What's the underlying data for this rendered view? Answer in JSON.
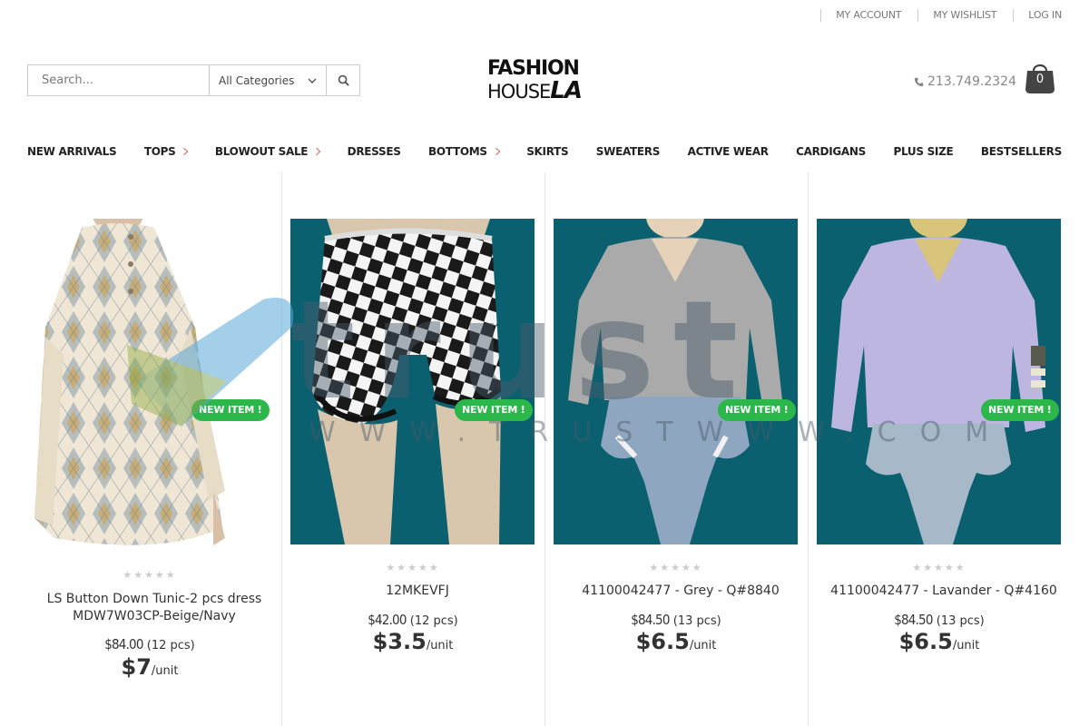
{
  "topbar": {
    "my_account": "MY ACCOUNT",
    "my_wishlist": "MY WISHLIST",
    "login": "LOG IN"
  },
  "search": {
    "placeholder": "Search...",
    "category": "All Categories"
  },
  "logo": {
    "line1": "FASHION",
    "line2a": "HOUSE",
    "line2b": "LA"
  },
  "phone": "213.749.2324",
  "cart": {
    "count": "0"
  },
  "nav": [
    {
      "label": "NEW ARRIVALS",
      "dropdown": false
    },
    {
      "label": "TOPS",
      "dropdown": true
    },
    {
      "label": "BLOWOUT SALE",
      "dropdown": true
    },
    {
      "label": "DRESSES",
      "dropdown": false
    },
    {
      "label": "BOTTOMS",
      "dropdown": true
    },
    {
      "label": "SKIRTS",
      "dropdown": false
    },
    {
      "label": "SWEATERS",
      "dropdown": false
    },
    {
      "label": "ACTIVE WEAR",
      "dropdown": false
    },
    {
      "label": "CARDIGANS",
      "dropdown": false
    },
    {
      "label": "PLUS SIZE",
      "dropdown": false
    },
    {
      "label": "BESTSELLERS",
      "dropdown": false
    }
  ],
  "products": [
    {
      "badge": "NEW ITEM !",
      "name": "LS Button Down Tunic-2 pcs dress MDW7W03CP-Beige/Navy",
      "pack_price": "$84.00",
      "pack_qty": "(12 pcs)",
      "unit_price": "$7",
      "unit": "/unit",
      "rating": 0
    },
    {
      "badge": "NEW ITEM !",
      "name": "12MKEVFJ",
      "pack_price": "$42.00",
      "pack_qty": "(12 pcs)",
      "unit_price": "$3.5",
      "unit": "/unit",
      "rating": 0
    },
    {
      "badge": "NEW ITEM !",
      "name": "41100042477 - Grey - Q#8840",
      "pack_price": "$84.50",
      "pack_qty": "(13 pcs)",
      "unit_price": "$6.5",
      "unit": "/unit",
      "rating": 0
    },
    {
      "badge": "NEW ITEM !",
      "name": "41100042477 - Lavander - Q#4160",
      "pack_price": "$84.50",
      "pack_qty": "(13 pcs)",
      "unit_price": "$6.5",
      "unit": "/unit",
      "rating": 0
    }
  ],
  "watermark": {
    "word": "trust",
    "url": "WWW.TRUSTWWW.COM"
  },
  "colors": {
    "accent": "#e36159",
    "badge": "#2cb74a",
    "image_bg": "#0a606e",
    "cart": "#444444"
  },
  "icons": [
    "search-icon",
    "chevron-down-icon",
    "phone-icon",
    "shopping-bag-icon",
    "star-icon"
  ]
}
